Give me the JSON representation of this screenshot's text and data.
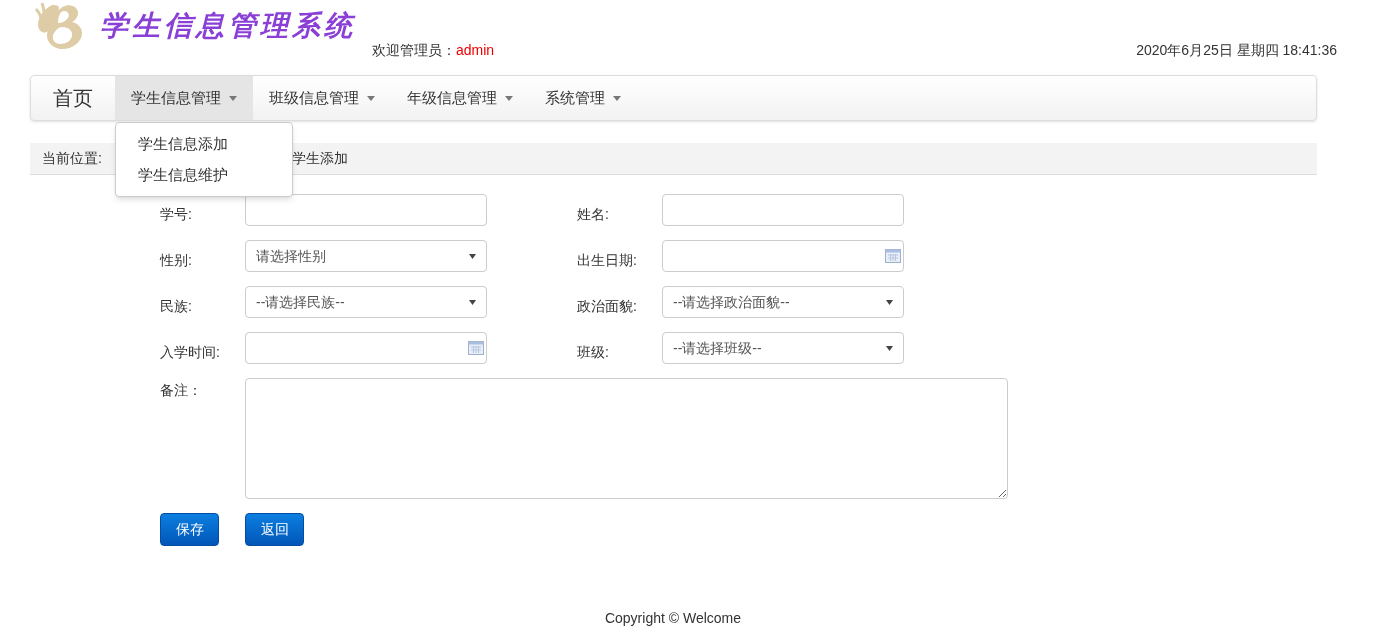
{
  "header": {
    "logo_text": "学生信息管理系统",
    "welcome_label": "欢迎管理员：",
    "username": "admin",
    "datetime": "2020年6月25日 星期四 18:41:36"
  },
  "nav": {
    "brand": "首页",
    "items": [
      {
        "label": "学生信息管理",
        "selected": true,
        "menu": [
          "学生信息添加",
          "学生信息维护"
        ]
      },
      {
        "label": "班级信息管理",
        "selected": false
      },
      {
        "label": "年级信息管理",
        "selected": false
      },
      {
        "label": "系统管理",
        "selected": false
      }
    ]
  },
  "breadcrumb": {
    "label": "当前位置:",
    "current": "学生添加"
  },
  "form": {
    "rows": [
      [
        {
          "label": "学号:",
          "kind": "text"
        },
        {
          "label": "姓名:",
          "kind": "text"
        }
      ],
      [
        {
          "label": "性别:",
          "kind": "select",
          "value": "请选择性别"
        },
        {
          "label": "出生日期:",
          "kind": "date"
        }
      ],
      [
        {
          "label": "民族:",
          "kind": "select",
          "value": "--请选择民族--"
        },
        {
          "label": "政治面貌:",
          "kind": "select",
          "value": "--请选择政治面貌--"
        }
      ],
      [
        {
          "label": "入学时间:",
          "kind": "date"
        },
        {
          "label": "班级:",
          "kind": "select",
          "value": "--请选择班级--"
        }
      ]
    ],
    "remarks_label": "备注："
  },
  "buttons": [
    "保存",
    "返回"
  ],
  "footer": "Copyright © Welcome"
}
